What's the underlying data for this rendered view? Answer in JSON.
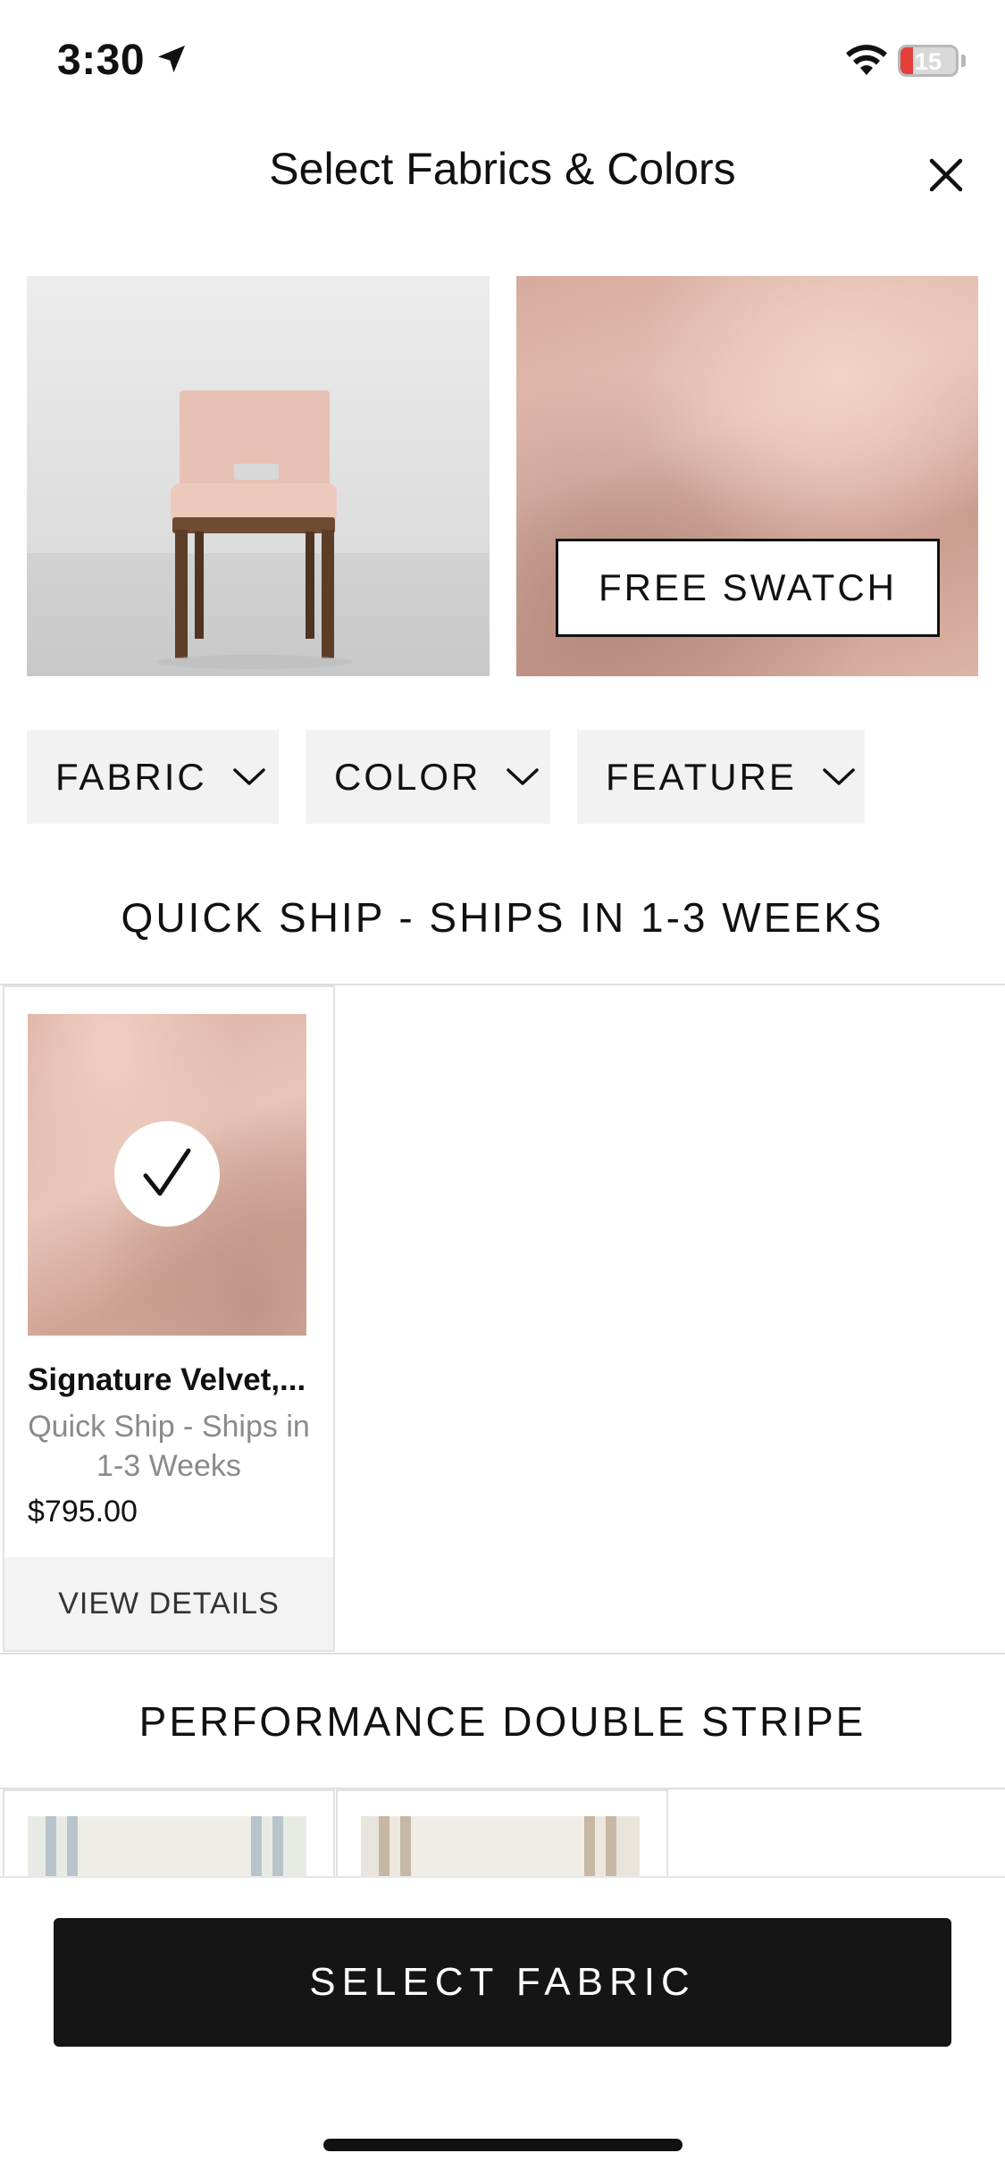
{
  "status_bar": {
    "time": "3:30",
    "battery_percent": "15"
  },
  "header": {
    "title": "Select Fabrics & Colors"
  },
  "hero": {
    "swatch_button": "FREE SWATCH"
  },
  "filters": [
    {
      "label": "FABRIC"
    },
    {
      "label": "COLOR"
    },
    {
      "label": "FEATURE"
    }
  ],
  "sections": {
    "quick_ship": {
      "title": "QUICK SHIP - SHIPS IN 1-3 WEEKS",
      "items": [
        {
          "name": "Signature Velvet,...",
          "subtitle": "Quick Ship - Ships in 1-3 Weeks",
          "price": "$795.00",
          "action": "VIEW DETAILS",
          "selected": true
        }
      ]
    },
    "double_stripe": {
      "title": "PERFORMANCE DOUBLE STRIPE"
    }
  },
  "footer": {
    "primary_button": "SELECT FABRIC"
  },
  "colors": {
    "accent_dark": "#151515",
    "filter_bg": "#f2f2f2",
    "battery_low": "#e5403a"
  },
  "icons": [
    "location-arrow-icon",
    "wifi-icon",
    "battery-icon",
    "close-icon",
    "chevron-down-icon",
    "checkmark-icon"
  ]
}
